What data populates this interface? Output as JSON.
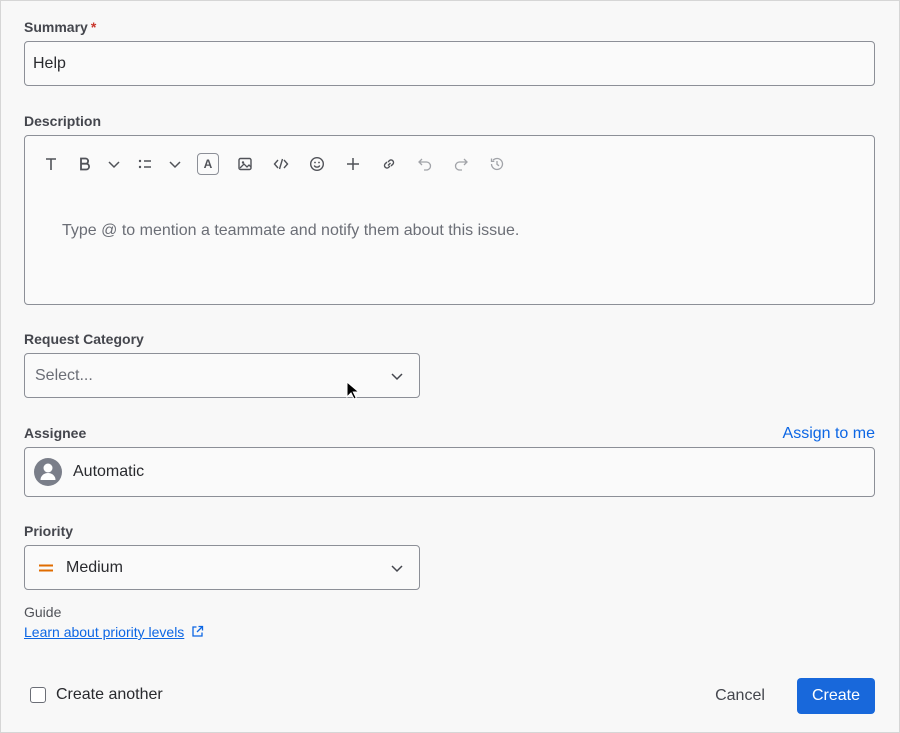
{
  "summary": {
    "label": "Summary",
    "required_mark": "*",
    "value": "Help"
  },
  "description": {
    "label": "Description",
    "placeholder": "Type @ to mention a teammate and notify them about this issue.",
    "toolbar": [
      "text-style-icon",
      "bold-icon",
      "chevron-down-icon",
      "list-icon",
      "chevron-down-icon",
      "text-color-icon",
      "image-icon",
      "code-icon",
      "emoji-icon",
      "plus-icon",
      "link-icon",
      "undo-icon",
      "redo-icon",
      "history-icon"
    ],
    "text_color_letter": "A"
  },
  "request_category": {
    "label": "Request Category",
    "placeholder": "Select..."
  },
  "assignee": {
    "label": "Assignee",
    "assign_to_me": "Assign to me",
    "value": "Automatic"
  },
  "priority": {
    "label": "Priority",
    "value": "Medium",
    "icon_color": "#e06c00"
  },
  "guide": {
    "label": "Guide",
    "link": "Learn about priority levels"
  },
  "footer": {
    "create_another": "Create another",
    "cancel": "Cancel",
    "create": "Create"
  },
  "colors": {
    "accent": "#1868db",
    "link": "#0c66e4",
    "required": "#c9372c"
  }
}
